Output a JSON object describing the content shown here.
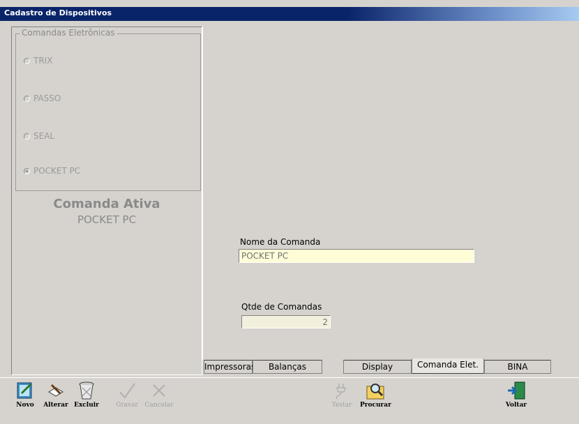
{
  "window": {
    "title": "Cadastro de Dispositivos"
  },
  "group": {
    "legend": "Comandas Eletrônicas",
    "options": [
      {
        "label": "TRIX",
        "selected": false
      },
      {
        "label": "PASSO",
        "selected": false
      },
      {
        "label": "SEAL",
        "selected": false
      },
      {
        "label": "POCKET PC",
        "selected": true
      }
    ]
  },
  "active": {
    "title": "Comanda Ativa",
    "value": "POCKET PC"
  },
  "form": {
    "nome_label": "Nome da Comanda",
    "nome_value": "POCKET PC",
    "qtde_label": "Qtde de Comandas",
    "qtde_value": "2"
  },
  "tabs": [
    {
      "label": "Impressoras",
      "active": false
    },
    {
      "label": "Balanças",
      "active": false
    },
    {
      "label": "Display",
      "active": false
    },
    {
      "label": "Comanda Elet.",
      "active": true
    },
    {
      "label": "BINA",
      "active": false
    }
  ],
  "toolbar": {
    "novo": "Novo",
    "alterar": "Alterar",
    "excluir": "Excluir",
    "gravar": "Gravar",
    "cancelar": "Cancelar",
    "testar": "Testar",
    "procurar": "Procurar",
    "voltar": "Voltar"
  }
}
